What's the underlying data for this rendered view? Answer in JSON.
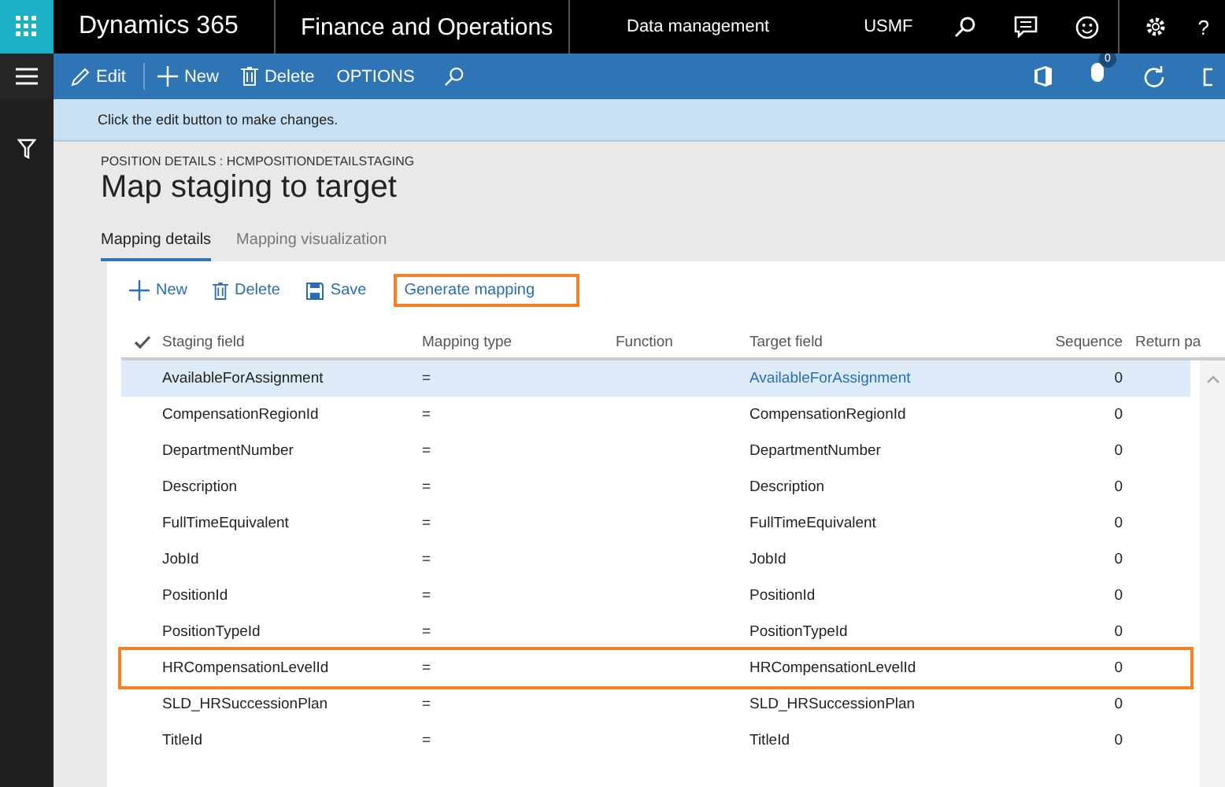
{
  "top_bar": {
    "product": "Dynamics 365",
    "app": "Finance and Operations",
    "module": "Data management",
    "company": "USMF",
    "help": "?"
  },
  "action_pane": {
    "items": [
      {
        "kind": "edit",
        "label": "Edit"
      },
      {
        "kind": "new",
        "label": "New"
      },
      {
        "kind": "delete",
        "label": "Delete"
      },
      {
        "kind": "text",
        "label": "OPTIONS"
      },
      {
        "kind": "search"
      }
    ],
    "notification_count": "0"
  },
  "message_bar": "Click the edit button to make changes.",
  "caption": "POSITION DETAILS : HCMPOSITIONDETAILSTAGING",
  "title": "Map staging to target",
  "tabs": [
    {
      "label": "Mapping details",
      "selected": true
    },
    {
      "label": "Mapping visualization",
      "selected": false
    }
  ],
  "grid_toolbar": [
    {
      "kind": "new",
      "label": "New",
      "annotated": false
    },
    {
      "kind": "delete",
      "label": "Delete",
      "annotated": false
    },
    {
      "kind": "save",
      "label": "Save",
      "annotated": false
    },
    {
      "kind": "text",
      "label": "Generate mapping",
      "annotated": true
    }
  ],
  "table": {
    "columns": [
      "Staging field",
      "Mapping type",
      "Function",
      "Target field",
      "Sequence",
      "Return pa"
    ],
    "rows": [
      {
        "staging": "AvailableForAssignment",
        "type": "=",
        "target": "AvailableForAssignment",
        "sequence": "0",
        "selected": true,
        "annotated": false
      },
      {
        "staging": "CompensationRegionId",
        "type": "=",
        "target": "CompensationRegionId",
        "sequence": "0",
        "selected": false,
        "annotated": false
      },
      {
        "staging": "DepartmentNumber",
        "type": "=",
        "target": "DepartmentNumber",
        "sequence": "0",
        "selected": false,
        "annotated": false
      },
      {
        "staging": "Description",
        "type": "=",
        "target": "Description",
        "sequence": "0",
        "selected": false,
        "annotated": false
      },
      {
        "staging": "FullTimeEquivalent",
        "type": "=",
        "target": "FullTimeEquivalent",
        "sequence": "0",
        "selected": false,
        "annotated": false
      },
      {
        "staging": "JobId",
        "type": "=",
        "target": "JobId",
        "sequence": "0",
        "selected": false,
        "annotated": false
      },
      {
        "staging": "PositionId",
        "type": "=",
        "target": "PositionId",
        "sequence": "0",
        "selected": false,
        "annotated": false
      },
      {
        "staging": "PositionTypeId",
        "type": "=",
        "target": "PositionTypeId",
        "sequence": "0",
        "selected": false,
        "annotated": false
      },
      {
        "staging": "HRCompensationLevelId",
        "type": "=",
        "target": "HRCompensationLevelId",
        "sequence": "0",
        "selected": false,
        "annotated": true
      },
      {
        "staging": "SLD_HRSuccessionPlan",
        "type": "=",
        "target": "SLD_HRSuccessionPlan",
        "sequence": "0",
        "selected": false,
        "annotated": false
      },
      {
        "staging": "TitleId",
        "type": "=",
        "target": "TitleId",
        "sequence": "0",
        "selected": false,
        "annotated": false
      }
    ]
  }
}
